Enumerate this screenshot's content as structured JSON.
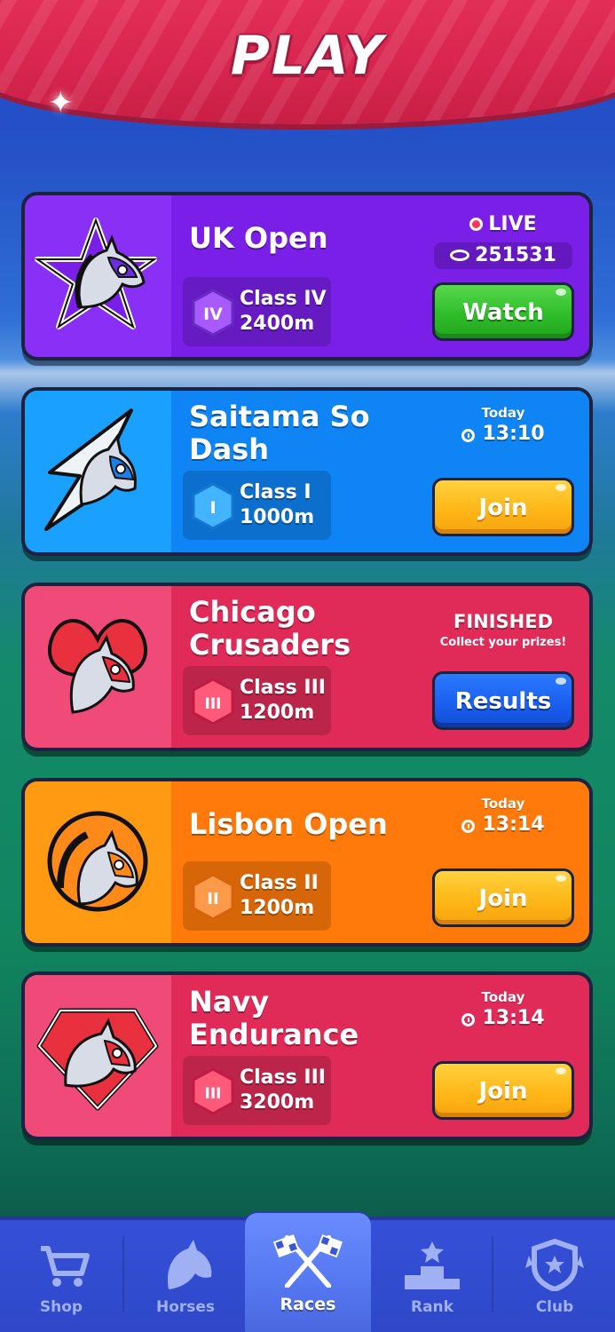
{
  "header": {
    "title": "PLAY"
  },
  "races": [
    {
      "name": "UK Open",
      "class": "Class IV",
      "numeral": "IV",
      "distance": "2400m",
      "status": "live",
      "live_label": "LIVE",
      "viewers": "251531",
      "button": "Watch",
      "color_main": "#7a1fe8",
      "color_left": "#8a2ff5",
      "badge_color": "#9b52f0"
    },
    {
      "name": "Saitama So Dash",
      "class": "Class I",
      "numeral": "I",
      "distance": "1000m",
      "status": "scheduled",
      "day": "Today",
      "time": "13:10",
      "button": "Join",
      "color_main": "#0f84f5",
      "color_left": "#1aa0ff",
      "badge_color": "#3aa8ff"
    },
    {
      "name": "Chicago Crusaders",
      "class": "Class III",
      "numeral": "III",
      "distance": "1200m",
      "status": "finished",
      "finished_label": "FINISHED",
      "finished_sub": "Collect your prizes!",
      "button": "Results",
      "color_main": "#e02b58",
      "color_left": "#f04a78",
      "badge_color": "#f05070"
    },
    {
      "name": "Lisbon Open",
      "class": "Class II",
      "numeral": "II",
      "distance": "1200m",
      "status": "scheduled",
      "day": "Today",
      "time": "13:14",
      "button": "Join",
      "color_main": "#ff7a0a",
      "color_left": "#ff9a12",
      "badge_color": "#ff8a2a"
    },
    {
      "name": "Navy Endurance",
      "class": "Class III",
      "numeral": "III",
      "distance": "3200m",
      "status": "scheduled",
      "day": "Today",
      "time": "13:14",
      "button": "Join",
      "color_main": "#e02b58",
      "color_left": "#f04a78",
      "badge_color": "#f05070"
    }
  ],
  "tabs": [
    {
      "label": "Shop",
      "icon": "cart-icon"
    },
    {
      "label": "Horses",
      "icon": "horse-head-icon"
    },
    {
      "label": "Races",
      "icon": "checkered-flags-icon",
      "active": true
    },
    {
      "label": "Rank",
      "icon": "podium-icon"
    },
    {
      "label": "Club",
      "icon": "shield-icon"
    }
  ]
}
